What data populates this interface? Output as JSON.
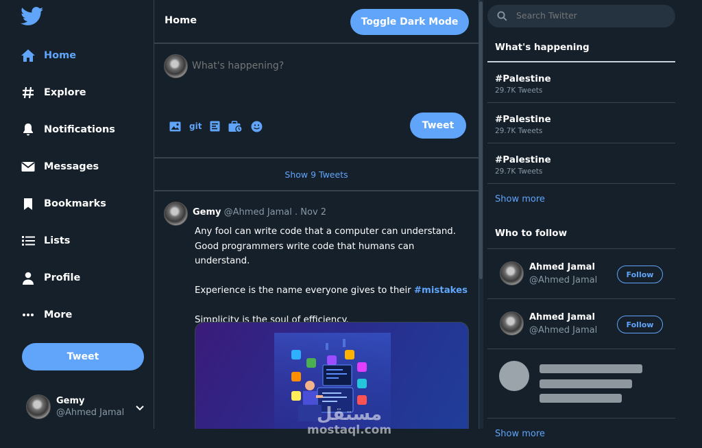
{
  "sidebar": {
    "logo_icon": "twitter-bird-icon",
    "items": [
      {
        "label": "Home",
        "icon": "home-icon",
        "active": true
      },
      {
        "label": "Explore",
        "icon": "hashtag-icon"
      },
      {
        "label": "Notifications",
        "icon": "bell-icon"
      },
      {
        "label": "Messages",
        "icon": "envelope-icon"
      },
      {
        "label": "Bookmarks",
        "icon": "bookmark-icon"
      },
      {
        "label": "Lists",
        "icon": "list-icon"
      },
      {
        "label": "Profile",
        "icon": "user-icon"
      },
      {
        "label": "More",
        "icon": "ellipsis-icon"
      }
    ],
    "tweet_button": "Tweet",
    "profile": {
      "name": "Gemy",
      "handle": "@Ahmed Jamal"
    }
  },
  "main": {
    "title": "Home",
    "toggle_button": "Toggle Dark Mode",
    "compose": {
      "placeholder": "What's happening?",
      "gif_label": "git",
      "tweet_button": "Tweet"
    },
    "show_tweets": "Show 9 Tweets",
    "tweet": {
      "name": "Gemy",
      "handle": "@Ahmed Jamal",
      "separator": " . ",
      "date": "Nov 2",
      "line1": "Any fool can write code that a computer can understand. Good programmers write code that humans can understand.",
      "line2_prefix": "Experience is the name everyone gives to their ",
      "line2_hashtag": "#mistakes",
      "line3": "Simplicity is the soul of efficiency."
    }
  },
  "right": {
    "search_placeholder": "Search Twitter",
    "happening_title": "What's happening",
    "trends": [
      {
        "tag": "#Palestine",
        "count": "29.7K Tweets"
      },
      {
        "tag": "#Palestine",
        "count": "29.7K Tweets"
      },
      {
        "tag": "#Palestine",
        "count": "29.7K Tweets"
      }
    ],
    "show_more_trends": "Show more",
    "follow_title": "Who to follow",
    "follow": [
      {
        "name": "Ahmed Jamal",
        "handle": "@Ahmed Jamal",
        "button": "Follow"
      },
      {
        "name": "Ahmed Jamal",
        "handle": "@Ahmed Jamal",
        "button": "Follow"
      }
    ],
    "show_more_follow": "Show more"
  },
  "watermark": {
    "arabic": "مستقل",
    "latin": "mostaql.com"
  },
  "colors": {
    "background": "#15202b",
    "accent": "#60a5fa",
    "border": "#38444d",
    "muted": "#8899a6"
  }
}
